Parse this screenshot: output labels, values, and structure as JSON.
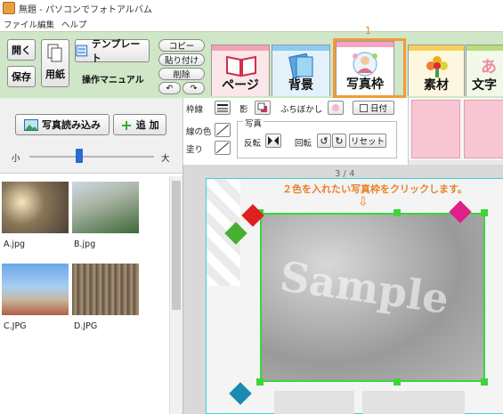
{
  "window": {
    "title": "無題 - パソコンでフォトアルバム"
  },
  "menu": [
    "ファイル",
    "編集",
    "ヘルプ"
  ],
  "toolbar": {
    "open": "開く",
    "save": "保存",
    "paper": "用紙",
    "template": "テンプレート",
    "manual": "操作マニュアル",
    "copy": "コピー",
    "paste": "貼り付け",
    "delete": "削除",
    "undo": "↶",
    "redo": "↷"
  },
  "tabs": [
    {
      "label": "ページ"
    },
    {
      "label": "背景"
    },
    {
      "label": "写真枠"
    },
    {
      "label": "素材"
    },
    {
      "label": "文字"
    }
  ],
  "annotation": {
    "step_number": "1",
    "instruction": "２色を入れたい写真枠をクリックします。"
  },
  "left_panel": {
    "load_photo": "写真読み込み",
    "add": "追 加",
    "size_small": "小",
    "size_large": "大",
    "slider_level": 0.4,
    "thumbnails": [
      {
        "caption": "A.jpg"
      },
      {
        "caption": "B.jpg"
      },
      {
        "caption": "C.JPG"
      },
      {
        "caption": "D.JPG"
      }
    ]
  },
  "properties": {
    "border": "枠線",
    "shadow": "影",
    "blur": "ふちぼかし",
    "date": "日付",
    "line_color": "線の色",
    "fill": "塗り",
    "photo": "写真",
    "flip": "反転",
    "rotate": "回転",
    "reset": "リセット"
  },
  "canvas": {
    "page_counter": "3 / 4",
    "watermark": "Sample"
  },
  "colors": {
    "toolbar_bg": "#cfe6c7",
    "accent_orange": "#f29a3a",
    "selection_green": "#3ad63a",
    "page_border": "#3cd0d0"
  }
}
